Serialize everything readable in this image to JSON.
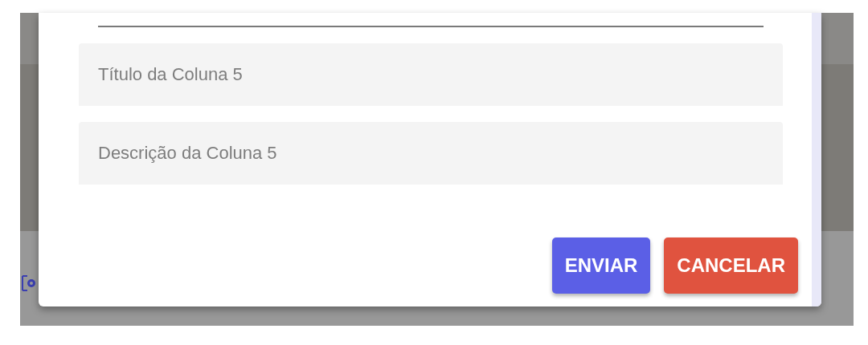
{
  "fields": [
    {
      "placeholder": "Título da Coluna 5"
    },
    {
      "placeholder": "Descrição da Coluna 5"
    }
  ],
  "buttons": [
    {
      "label": "ENVIAR",
      "kind": "primary"
    },
    {
      "label": "CANCELAR",
      "kind": "danger"
    }
  ]
}
